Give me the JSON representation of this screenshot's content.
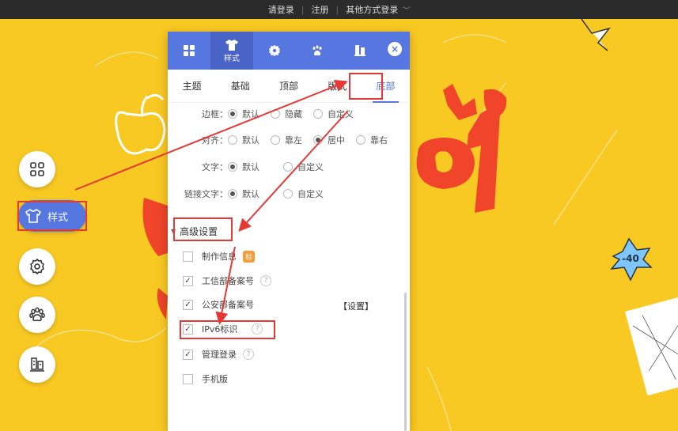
{
  "topbar": {
    "login": "请登录",
    "register": "注册",
    "other_login": "其他方式登录"
  },
  "toolbar": {
    "active_label": "样式"
  },
  "panel": {
    "tabs": [
      {
        "icon": "grid-icon",
        "label": ""
      },
      {
        "icon": "tshirt-icon",
        "label": "样式"
      },
      {
        "icon": "gear-icon",
        "label": ""
      },
      {
        "icon": "paw-icon",
        "label": ""
      },
      {
        "icon": "building-icon",
        "label": ""
      }
    ],
    "subtabs": [
      "主题",
      "基础",
      "顶部",
      "版式",
      "底部"
    ],
    "active_subtab": "底部",
    "border_row": {
      "label": "边框：",
      "options": [
        "默认",
        "隐藏",
        "自定义"
      ],
      "selected": "默认"
    },
    "align_row": {
      "label": "对齐：",
      "options": [
        "默认",
        "靠左",
        "居中",
        "靠右"
      ],
      "selected": "居中"
    },
    "text_row": {
      "label": "文字：",
      "options": [
        "默认",
        "自定义"
      ],
      "selected": "默认"
    },
    "link_row": {
      "label": "链接文字：",
      "options": [
        "默认",
        "自定义"
      ],
      "selected": "默认"
    },
    "advanced_title": "高级设置",
    "checks": [
      {
        "label": "制作信息",
        "checked": false,
        "badge": "标"
      },
      {
        "label": "工信部备案号",
        "checked": true,
        "help": "?"
      },
      {
        "label": "公安部备案号",
        "checked": true,
        "setting": "【设置】"
      },
      {
        "label": "IPv6标识",
        "checked": true,
        "help": "?"
      },
      {
        "label": "管理登录",
        "checked": true,
        "help": "?"
      },
      {
        "label": "手机版",
        "checked": false
      }
    ]
  },
  "colors": {
    "accent": "#5676e0",
    "highlight": "#e53935",
    "background": "#f9c923"
  }
}
